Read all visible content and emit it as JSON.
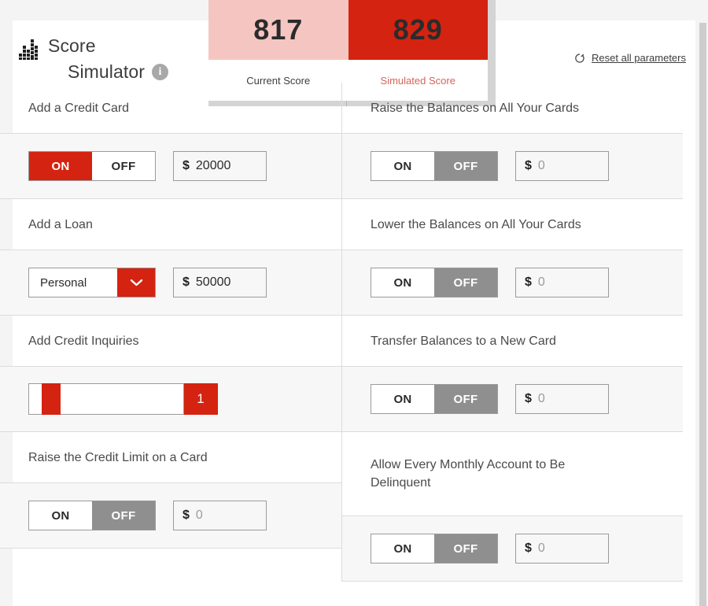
{
  "header": {
    "brand_line1": "Score",
    "brand_line2": "Simulator",
    "info_icon_glyph": "i",
    "reset_label": "Reset all parameters",
    "reset_icon": "refresh-icon"
  },
  "score_panel": {
    "current_value": "817",
    "current_label": "Current Score",
    "simulated_value": "829",
    "simulated_label": "Simulated Score",
    "current_bg": "#f5c6c1",
    "simulated_bg": "#d42310",
    "simulated_label_color": "#d4645a"
  },
  "toggle_labels": {
    "on": "ON",
    "off": "OFF"
  },
  "currency_symbol": "$",
  "accent_color": "#d42310",
  "left_column": [
    {
      "label": "Add a Credit Card",
      "control": "toggle",
      "state": "ON",
      "amount": "20000",
      "amount_is_placeholder": false
    },
    {
      "label": "Add a Loan",
      "control": "select",
      "selected_option": "Personal",
      "amount": "50000",
      "amount_is_placeholder": false
    },
    {
      "label": "Add Credit Inquiries",
      "control": "slider",
      "value": "1",
      "min": "0",
      "max": "10",
      "handle_percent": 8
    },
    {
      "label": "Raise the Credit Limit on a Card",
      "control": "toggle",
      "state": "OFF",
      "amount": "0",
      "amount_is_placeholder": true
    }
  ],
  "right_column": [
    {
      "label": "Raise the Balances on All Your Cards",
      "control": "toggle",
      "state": "OFF",
      "amount": "0",
      "amount_is_placeholder": true
    },
    {
      "label": "Lower the Balances on All Your Cards",
      "control": "toggle",
      "state": "OFF",
      "amount": "0",
      "amount_is_placeholder": true
    },
    {
      "label": "Transfer Balances to a New Card",
      "control": "toggle",
      "state": "OFF",
      "amount": "0",
      "amount_is_placeholder": true
    },
    {
      "label_line1": "Allow Every Monthly Account to Be",
      "label_line2": "Delinquent",
      "label": "Allow Every Monthly Account to Be Delinquent",
      "control": "toggle",
      "state": "OFF",
      "amount": "0",
      "amount_is_placeholder": true,
      "partially_visible": true
    }
  ]
}
